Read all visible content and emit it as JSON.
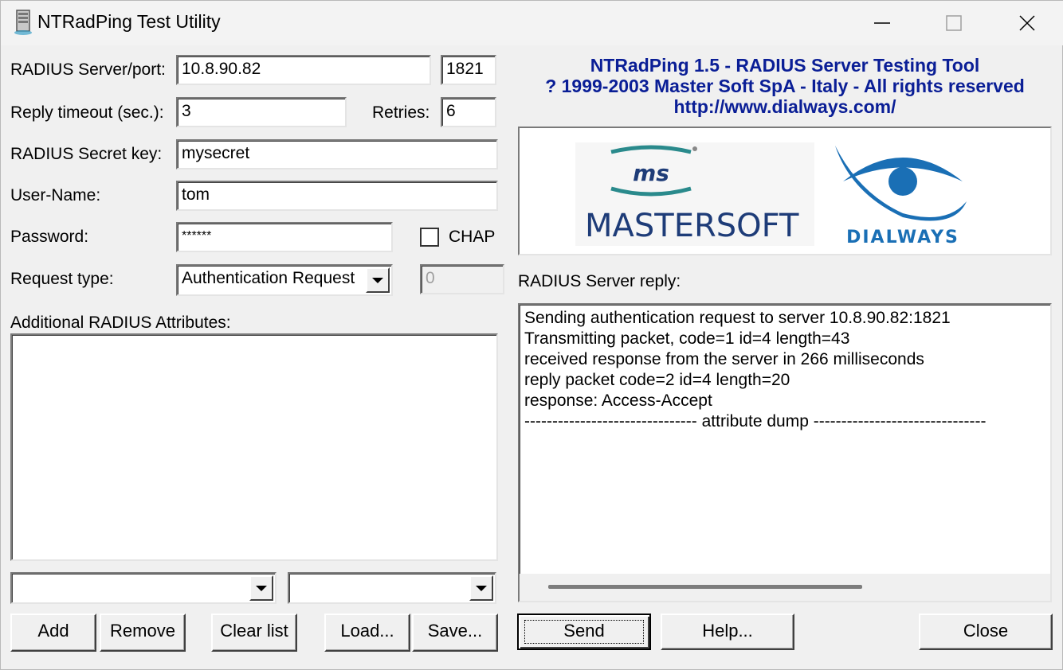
{
  "window": {
    "title": "NTRadPing Test Utility"
  },
  "form": {
    "server_port_label": "RADIUS Server/port:",
    "server_value": "10.8.90.82",
    "port_value": "1821",
    "timeout_label": "Reply timeout (sec.):",
    "timeout_value": "3",
    "retries_label": "Retries:",
    "retries_value": "6",
    "secret_label": "RADIUS Secret key:",
    "secret_value": "mysecret",
    "username_label": "User-Name:",
    "username_value": "tom",
    "password_label": "Password:",
    "password_value": "******",
    "chap_label": "CHAP",
    "request_type_label": "Request type:",
    "request_type_value": "Authentication Request",
    "request_id_value": "0",
    "attributes_label": "Additional RADIUS Attributes:",
    "attr_name_combo": "",
    "attr_value_combo": ""
  },
  "buttons": {
    "add": "Add",
    "remove": "Remove",
    "clear_list": "Clear list",
    "load": "Load...",
    "save": "Save...",
    "send": "Send",
    "help": "Help...",
    "close": "Close"
  },
  "banner": {
    "line1": "NTRadPing 1.5 - RADIUS Server Testing Tool",
    "line2": "? 1999-2003 Master Soft SpA - Italy - All rights reserved",
    "line3": "http://www.dialways.com/"
  },
  "logos": {
    "mastersoft_text": "MASTERSOFT",
    "ms_text": "ms",
    "dialways_text": "DIALWAYS"
  },
  "reply": {
    "label": "RADIUS Server reply:",
    "lines": [
      "Sending authentication request to server 10.8.90.82:1821",
      "Transmitting packet, code=1 id=4 length=43",
      "received response from the server in 266 milliseconds",
      "reply packet code=2 id=4 length=20",
      "response: Access-Accept",
      "------------------------------- attribute dump -------------------------------"
    ]
  },
  "colors": {
    "banner_text": "#0a1e96",
    "logo_blue": "#1e3c78",
    "logo_teal": "#2a8a8c",
    "eye_blue": "#1a6fb5"
  }
}
